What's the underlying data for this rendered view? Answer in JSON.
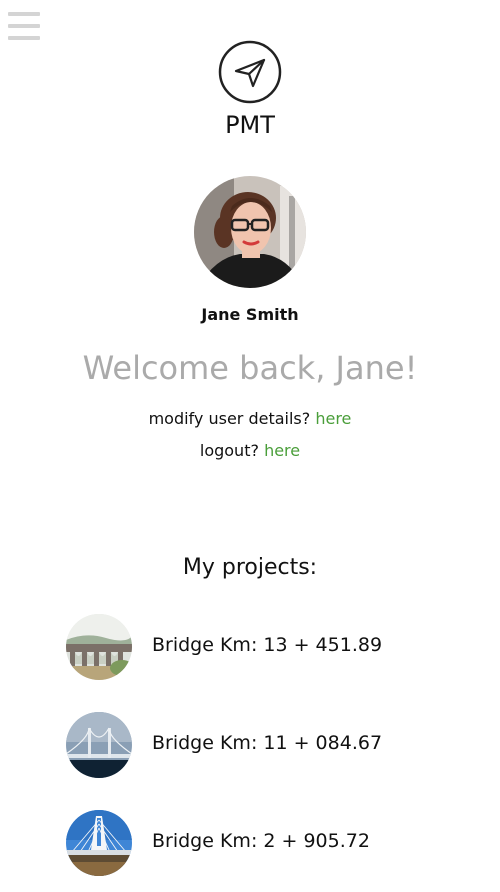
{
  "app": {
    "title": "PMT",
    "logo_icon": "paper-plane-icon"
  },
  "menu": {
    "icon": "hamburger-menu-icon"
  },
  "user": {
    "name": "Jane Smith",
    "welcome": "Welcome back, Jane!",
    "avatar": "user-avatar-photo"
  },
  "links": {
    "modify_text": "modify user details?",
    "modify_link": "here",
    "logout_text": "logout?",
    "logout_link": "here",
    "link_color": "#4a9e3a"
  },
  "projects": {
    "heading": "My projects:",
    "items": [
      {
        "title": "Bridge Km: 13 + 451.89",
        "thumb": "stone-arch-viaduct-photo"
      },
      {
        "title": "Bridge Km: 11 + 084.67",
        "thumb": "suspension-bridge-photo"
      },
      {
        "title": "Bridge Km: 2 + 905.72",
        "thumb": "cable-stayed-bridge-photo"
      }
    ]
  }
}
